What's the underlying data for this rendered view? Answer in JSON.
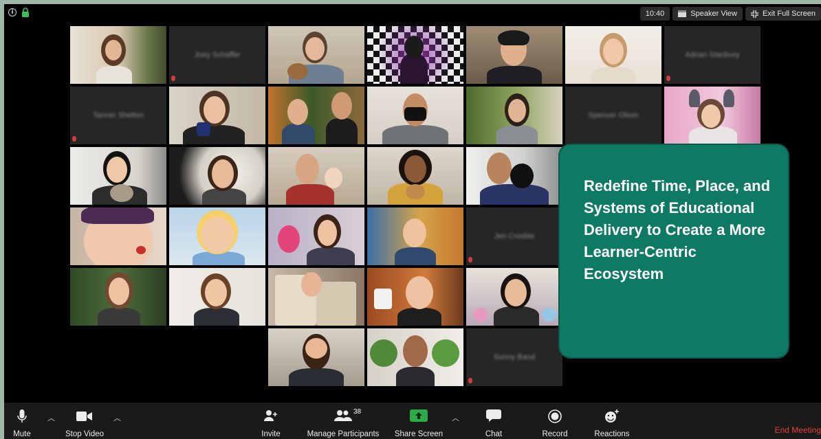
{
  "top_bar": {
    "time": "10:40",
    "speaker_view_label": "Speaker View",
    "exit_full_screen_label": "Exit Full Screen"
  },
  "participants_visible_names": [
    "Joey Schaffer",
    "Adrian Stanbury",
    "Tanner Shelton",
    "Spencer Olson",
    "Jen Crosbie",
    "Sunny Band"
  ],
  "callout": {
    "text": "Redefine Time, Place, and Systems of Educational Delivery to Create a More Learner-Centric Ecosystem"
  },
  "toolbar": {
    "mute_label": "Mute",
    "stop_video_label": "Stop Video",
    "invite_label": "Invite",
    "manage_participants_label": "Manage Participants",
    "participant_count": "38",
    "share_screen_label": "Share Screen",
    "chat_label": "Chat",
    "record_label": "Record",
    "reactions_label": "Reactions",
    "end_meeting_label": "End Meeting"
  },
  "colors": {
    "callout_bg": "#0f7a63",
    "share_green": "#2eaa49",
    "end_meeting_red": "#e2413b",
    "muted_red": "#d23b3b"
  }
}
